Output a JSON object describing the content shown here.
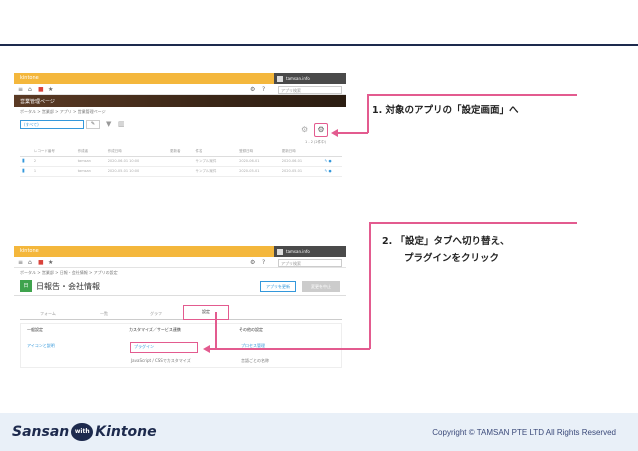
{
  "steps": {
    "step1": "1. 対象のアプリの「設定画面」へ",
    "step2_line1": "2. 「設定」タブへ切り替え、",
    "step2_line2": "プラグインをクリック"
  },
  "screen1": {
    "brand": "kintone",
    "user": "tamsan.info",
    "search_placeholder": "アプリ検索",
    "app_header": "営業管理ページ",
    "breadcrumb": "ポータル > 営業部 > アプリ > 営業管理ページ",
    "view_selector": "(すべて)",
    "pager": "1 - 2 (2件中)",
    "table_headers": [
      "レコード番号",
      "作成者",
      "作成日時",
      "更新者",
      "件名",
      "登録日時",
      "更新日時"
    ],
    "rows": [
      [
        "2",
        "tamsan",
        "2020-06-01 10:00",
        "",
        "サンプル案件",
        "2020-06-01",
        "2020-06-01"
      ],
      [
        "1",
        "tamsan",
        "2020-05-01 10:00",
        "",
        "サンプル案件",
        "2020-05-01",
        "2020-05-01"
      ]
    ]
  },
  "screen2": {
    "brand": "kintone",
    "user": "tamsan.info",
    "search_placeholder": "アプリ検索",
    "breadcrumb": "ポータル > 営業部 > 日報・会社情報 > アプリの設定",
    "app_icon": "日",
    "app_title": "日報告・会社情報",
    "save_button": "アプリを更新",
    "cancel_button": "変更を中止",
    "tabs": [
      "フォーム",
      "一覧",
      "グラフ",
      "設定"
    ],
    "sections": [
      {
        "heading": "一般設定",
        "link": "アイコンと説明"
      },
      {
        "heading": "カスタマイズ／サービス連携",
        "link": "プラグイン",
        "link2": "JavaScript / CSSでカスタマイズ"
      },
      {
        "heading": "その他の設定",
        "link": "プロセス管理",
        "link2": "言語ごとの名称"
      }
    ]
  },
  "footer": {
    "logo_left": "Sansan",
    "logo_with": "with",
    "logo_right": "Kintone",
    "copyright": "Copyright © TAMSAN PTE LTD All Rights Reserved"
  },
  "colors": {
    "accent": "#e35b8f",
    "navy": "#1d2a4d",
    "kintone_yellow": "#f4b73c",
    "footer_bg": "#e9f0f8"
  }
}
